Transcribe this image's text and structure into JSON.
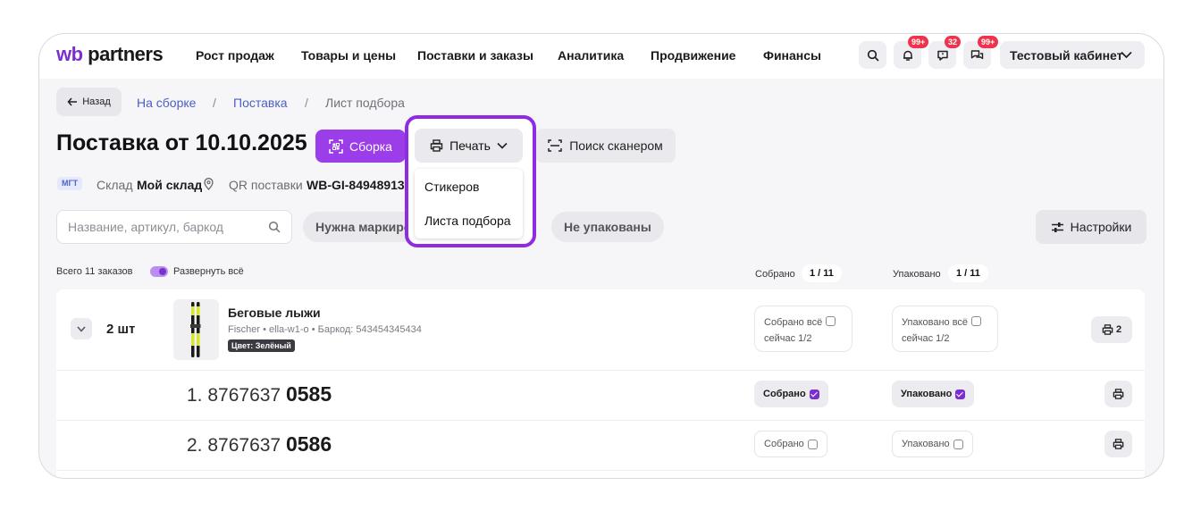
{
  "header": {
    "logo_wb": "wb",
    "logo_rest": " partners",
    "nav": [
      "Рост продаж",
      "Товары и цены",
      "Поставки и заказы",
      "Аналитика",
      "Продвижение",
      "Финансы"
    ],
    "badges": {
      "notifications": "99+",
      "feedback": "32",
      "chats": "99+"
    },
    "account": "Тестовый кабинет"
  },
  "breadcrumb": {
    "back": "Назад",
    "items": [
      "На сборке",
      "Поставка",
      "Лист подбора"
    ],
    "sep": "/"
  },
  "page": {
    "title": "Поставка от 10.10.2025",
    "assemble_button": "Сборка",
    "print_button": "Печать",
    "print_menu": [
      "Стикеров",
      "Листа подбора"
    ],
    "scan_button": "Поиск сканером"
  },
  "meta": {
    "tag": "МГТ",
    "warehouse_label": "Склад",
    "warehouse_value": "Мой склад",
    "qr_label": "QR поставки",
    "qr_value": "WB-GI-84948913"
  },
  "filters": {
    "search_placeholder": "Название, артикул, баркод",
    "chips": [
      "Нужна маркировка",
      "Не упакованы"
    ],
    "settings_button": "Настройки"
  },
  "summary": {
    "total": "Всего 11 заказов",
    "expand_all": "Развернуть всё",
    "collected_label": "Собрано",
    "collected_value": "1 / 11",
    "packed_label": "Упаковано",
    "packed_value": "1 / 11"
  },
  "product": {
    "qty": "2 шт",
    "name": "Беговые лыжи",
    "meta": "Fischer • ella-w1-o • Баркод: 543454345434",
    "tag": "Цвет: Зелёный",
    "collected_all": "Собрано всё",
    "collected_now": "сейчас 1/2",
    "packed_all": "Упаковано всё",
    "packed_now": "сейчас 1/2",
    "print_count": "2"
  },
  "items": [
    {
      "index": "1.",
      "prefix": "8767637",
      "suffix": "0585",
      "collected": "Собрано",
      "packed": "Упаковано",
      "collected_checked": true,
      "packed_checked": true
    },
    {
      "index": "2.",
      "prefix": "8767637",
      "suffix": "0586",
      "collected": "Собрано",
      "packed": "Упаковано",
      "collected_checked": false,
      "packed_checked": false
    }
  ],
  "colors": {
    "accent": "#9c3dea",
    "highlight": "#8d2ce3",
    "badge": "#f0334d",
    "link": "#4b5fc2"
  }
}
